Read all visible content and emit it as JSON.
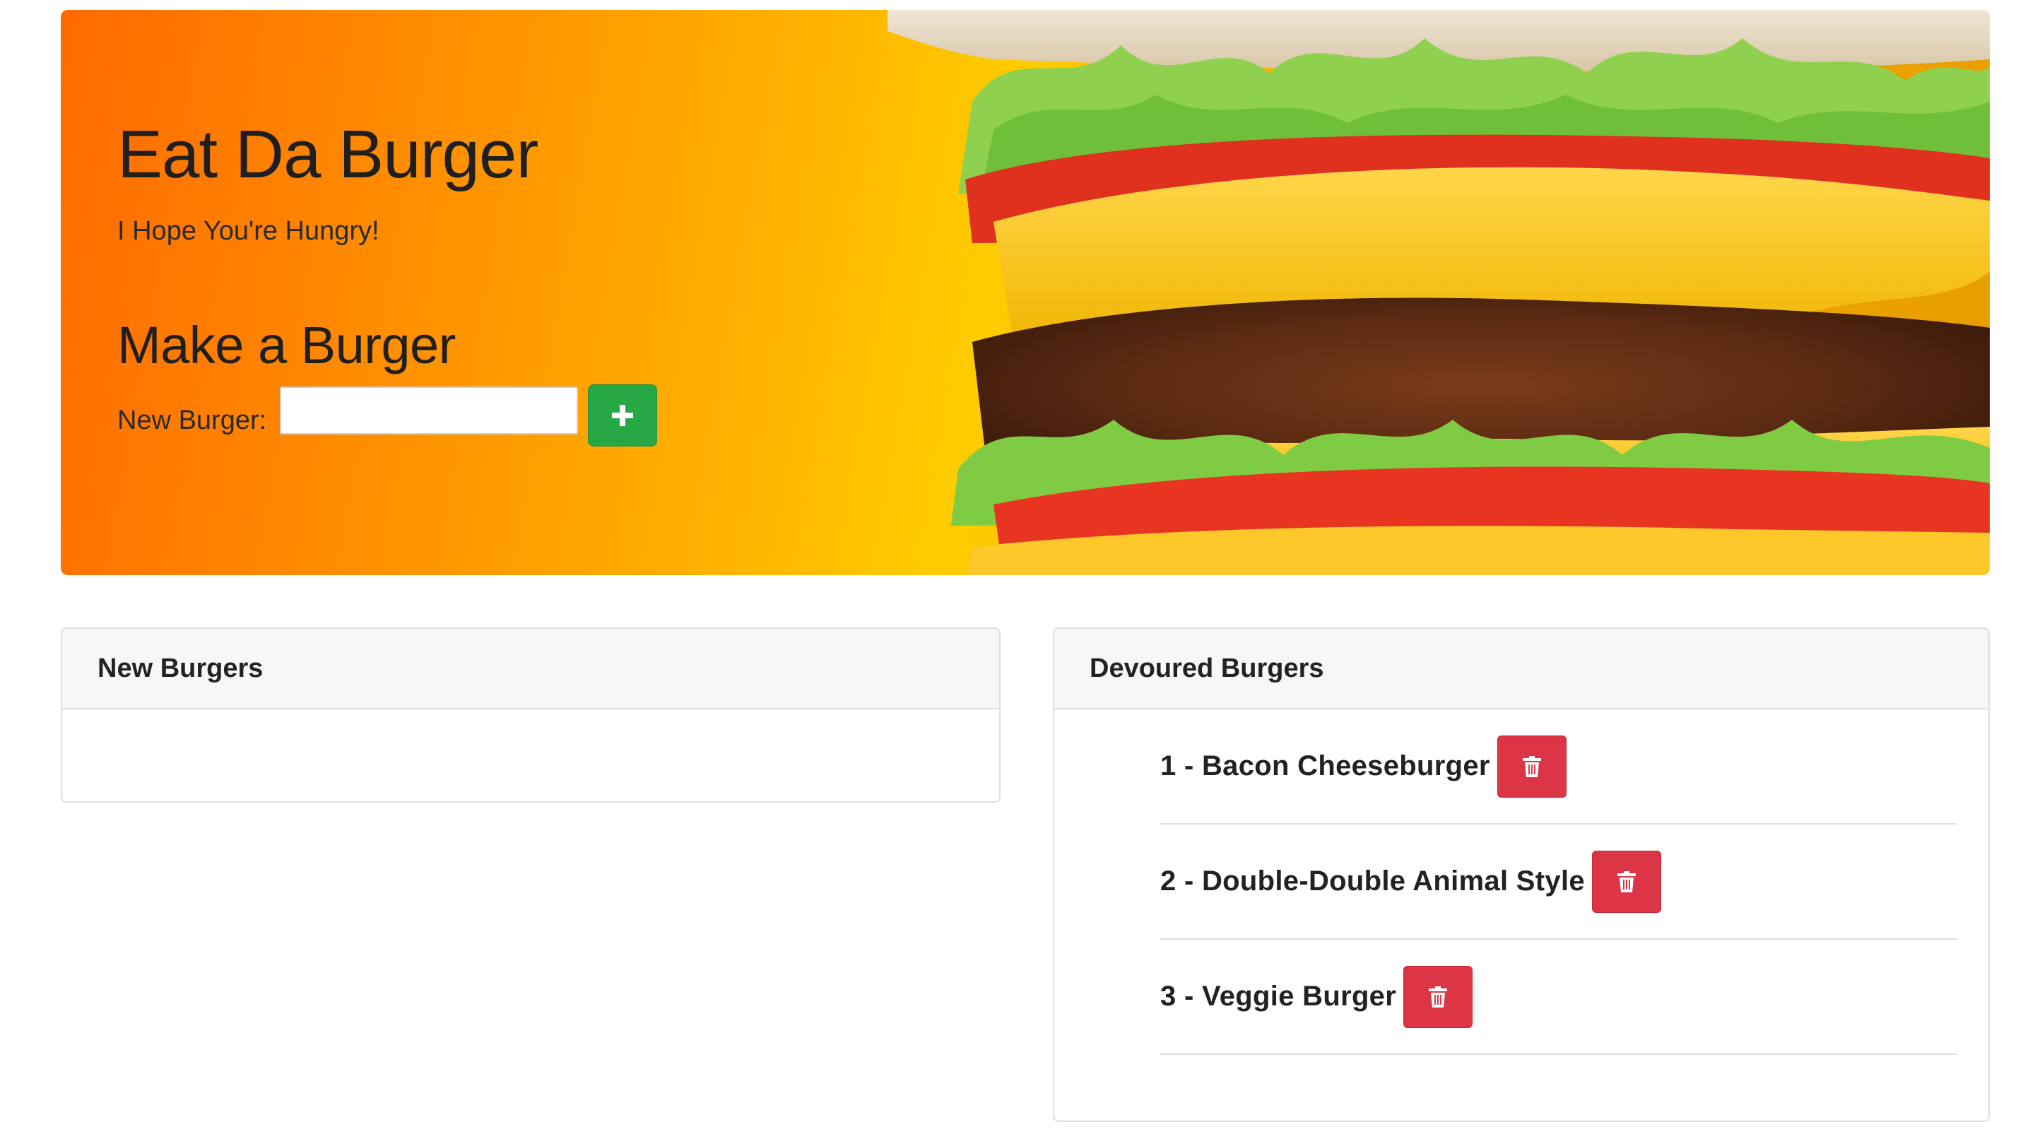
{
  "hero": {
    "title": "Eat Da Burger",
    "subtitle": "I Hope You're Hungry!",
    "form_title": "Make a Burger",
    "input_label": "New Burger:",
    "input_value": "",
    "add_icon": "plus-icon"
  },
  "new_burgers": {
    "header": "New Burgers",
    "items": []
  },
  "devoured_burgers": {
    "header": "Devoured Burgers",
    "items": [
      {
        "label": "1 - Bacon Cheeseburger",
        "action_icon": "trash-icon"
      },
      {
        "label": "2 - Double-Double Animal Style",
        "action_icon": "trash-icon"
      },
      {
        "label": "3 - Veggie Burger",
        "action_icon": "trash-icon"
      }
    ]
  },
  "colors": {
    "add_button": "#28a745",
    "delete_button": "#dc3545",
    "hero_orange": "#ff6a00",
    "hero_yellow": "#ffcc00"
  }
}
